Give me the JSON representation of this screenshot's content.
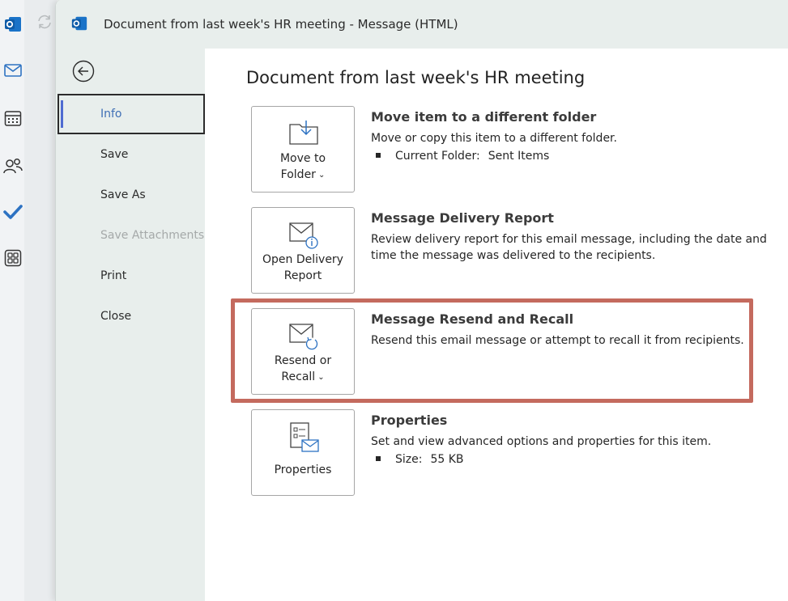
{
  "window": {
    "title": "Document from last week's HR meeting  -  Message (HTML)"
  },
  "app_rail": {
    "icons": [
      "outlook-logo-icon",
      "mail-icon",
      "calendar-icon",
      "people-icon",
      "todo-check-icon",
      "apps-grid-icon"
    ]
  },
  "backstage_nav": {
    "items": [
      {
        "label": "Info",
        "selected": true,
        "disabled": false
      },
      {
        "label": "Save",
        "selected": false,
        "disabled": false
      },
      {
        "label": "Save As",
        "selected": false,
        "disabled": false
      },
      {
        "label": "Save Attachments",
        "selected": false,
        "disabled": true
      },
      {
        "label": "Print",
        "selected": false,
        "disabled": false
      },
      {
        "label": "Close",
        "selected": false,
        "disabled": false
      }
    ]
  },
  "info": {
    "page_title": "Document from last week's HR meeting",
    "sections": [
      {
        "tile_line1": "Move to",
        "tile_line2": "Folder",
        "has_dropdown": true,
        "title": "Move item to a different folder",
        "description": "Move or copy this item to a different folder.",
        "bullet_label": "Current Folder:",
        "bullet_value": "Sent Items"
      },
      {
        "tile_line1": "Open Delivery",
        "tile_line2": "Report",
        "has_dropdown": false,
        "title": "Message Delivery Report",
        "description": "Review delivery report for this email message, including the date and time the message was delivered to the recipients."
      },
      {
        "tile_line1": "Resend or",
        "tile_line2": "Recall",
        "has_dropdown": true,
        "title": "Message Resend and Recall",
        "description": "Resend this email message or attempt to recall it from recipients."
      },
      {
        "tile_line1": "",
        "tile_line2": "Properties",
        "has_dropdown": false,
        "title": "Properties",
        "description": "Set and view advanced options and properties for this item.",
        "bullet_label": "Size:",
        "bullet_value": "55 KB"
      }
    ]
  },
  "colors": {
    "accent": "#4f6bd1",
    "highlight_box": "#c46a5e",
    "nav_background": "#e8eeec"
  }
}
